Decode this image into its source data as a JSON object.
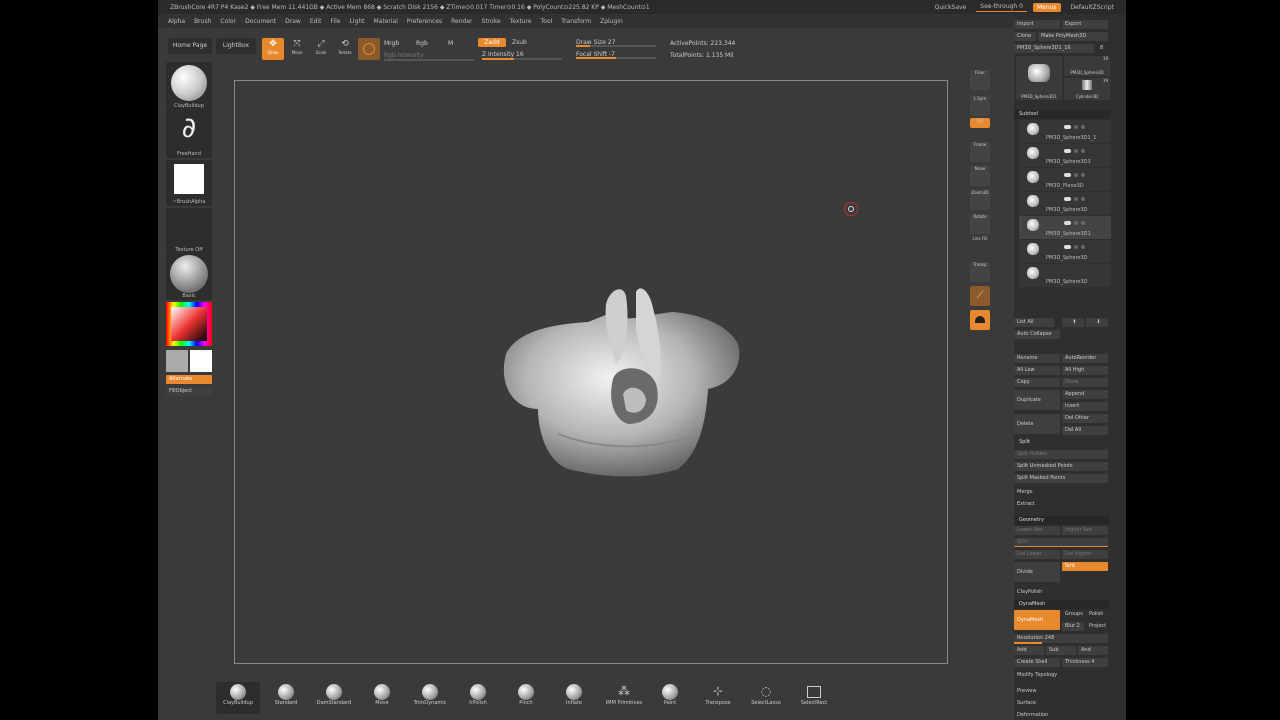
{
  "titlebar": {
    "title": "ZBrushCore 4R7 P4   Kase2   ◆ Free Mem 11.441GB ◆ Active Mem 868 ◆ Scratch Disk 2156 ◆ ZTime⊙0.017 Timer⊙0.16 ◆ PolyCount⊙225.82 KP ◆ MeshCount⊙1",
    "quicksave": "QuickSave",
    "seethrough": "See-through   0",
    "menus": "Menus",
    "script": "DefaultZScript"
  },
  "menubar": [
    "Alpha",
    "Brush",
    "Color",
    "Document",
    "Draw",
    "Edit",
    "File",
    "Light",
    "Material",
    "Preferences",
    "Render",
    "Stroke",
    "Texture",
    "Tool",
    "Transform",
    "Zplugin"
  ],
  "topshelf": {
    "home_page": "Home Page",
    "lightbox": "LightBox",
    "draw": "Draw",
    "move": "Move",
    "scale": "Scale",
    "rotate": "Rotate",
    "mrgb": "Mrgb",
    "rgb": "Rgb",
    "m": "M",
    "rgb_intensity": "Rgb Intensity",
    "zadd": "Zadd",
    "zsub": "Zsub",
    "z_intensity": "Z Intensity 16",
    "draw_size": "Draw Size 27",
    "focal_shift": "Focal Shift -7",
    "active_points": "ActivePoints: 223,344",
    "total_points": "TotalPoints: 1.135 Mil"
  },
  "leftshelf": {
    "brush": "ClayBuildup",
    "stroke": "FreeHand",
    "alpha": "~BrushAlpha",
    "texture": "Texture Off",
    "material": "Basic",
    "alternate": "Alternate",
    "fill_object": "FillObject"
  },
  "rightshelf": [
    "Floor",
    "L.Sym",
    "Xyz",
    "Frame",
    "Move",
    "Zoom3D",
    "Rotate",
    "Line Fill",
    "Transp",
    "",
    ""
  ],
  "bottomshelf": [
    "ClayBuildup",
    "Standard",
    "DamStandard",
    "Move",
    "TrimDynamic",
    "hPolish",
    "Pinch",
    "Inflate",
    "IMM Primitives",
    "Paint",
    "Transpose",
    "SelectLasso",
    "SelectRect"
  ],
  "rpanel": {
    "import": "Import",
    "export": "Export",
    "clone": "Clone",
    "make_polymesh": "Make PolyMesh3D",
    "tool_name": "PM3D_Sphere3D1_16",
    "tool_count": "8",
    "thumb1": "PM3D_Sphere3D1",
    "thumb2": "PM3D_Sphere3D",
    "thumb3": "Cylinder3D",
    "thumb_num1": "19",
    "thumb_num2": "19",
    "subtool_header": "Subtool",
    "subtools": [
      "PM3D_Sphere3D1_1",
      "PM3D_Sphere3D3",
      "PM3D_Plane3D",
      "PM3D_Sphere3D",
      "PM3D_Sphere3D1",
      "PM3D_Sphere3D",
      "PM3D_Sphere3D"
    ],
    "list_all": "List All",
    "auto_collapse": "Auto Collapse",
    "rename": "Rename",
    "autoreorder": "AutoReorder",
    "all_low": "All Low",
    "all_high": "All High",
    "copy": "Copy",
    "paste": "Paste",
    "duplicate": "Duplicate",
    "append": "Append",
    "insert": "Insert",
    "delete": "Delete",
    "del_other": "Del Other",
    "del_all": "Del All",
    "split_header": "Split",
    "split_hidden": "Split Hidden",
    "split_unmasked": "Split Unmasked Points",
    "split_masked": "Split Masked Points",
    "merge": "Merge",
    "extract": "Extract",
    "geometry_header": "Geometry",
    "lower_res": "Lower Res",
    "higher_res": "Higher Res",
    "sdiv": "SDiv",
    "del_lower": "Del Lower",
    "del_higher": "Del Higher",
    "divide": "Divide",
    "smt": "Smt",
    "claypolish": "ClayPolish",
    "dynamesh_header": "DynaMesh",
    "dynamesh": "DynaMesh",
    "groups": "Groups",
    "polish": "Polish",
    "blur": "Blur 2",
    "project": "Project",
    "resolution": "Resolution 248",
    "add": "Add",
    "sub": "Sub",
    "and": "And",
    "create_shell": "Create Shell",
    "thickness": "Thickness 4",
    "modify_topology": "Modify Topology",
    "preview": "Preview",
    "surface": "Surface",
    "deformation": "Deformation"
  },
  "colors": {
    "accent": "#e8892e",
    "bg": "#3a3a3a"
  }
}
